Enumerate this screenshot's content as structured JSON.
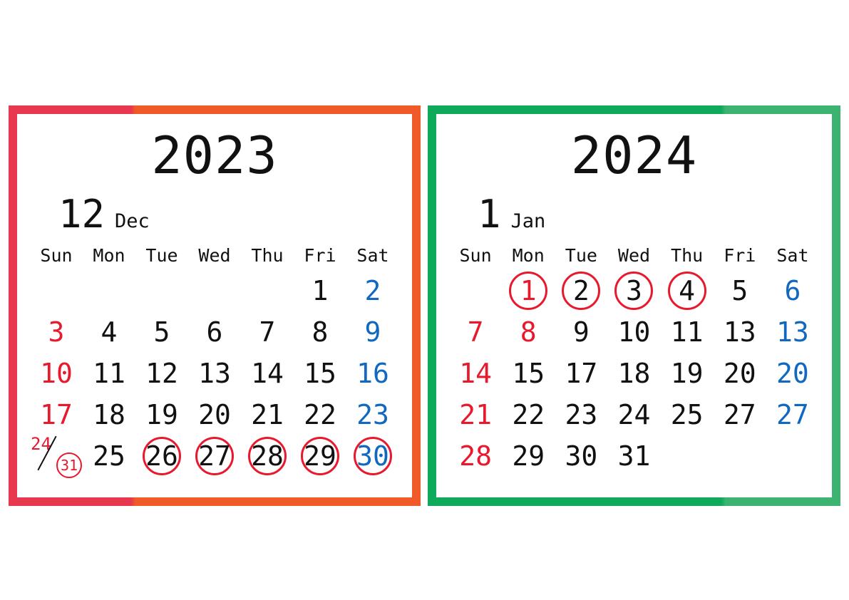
{
  "document": {
    "kind": "two-month-calendar",
    "background_color": "#FFFFFF"
  },
  "colors": {
    "sunday_red": "#E8192C",
    "saturday_blue": "#1068C0",
    "weekday_black": "#111111",
    "circle_red": "#E8192C",
    "dec_border_left": "#E8384F",
    "dec_border_right": "#F05A28",
    "jan_border_left": "#0EA95A",
    "jan_border_right": "#3CB371"
  },
  "calendars": [
    {
      "id": "december-2023",
      "year": "2023",
      "month_number": "12",
      "month_abbr": "Dec",
      "weekday_headers": [
        {
          "label": "Sun",
          "tone": "sun"
        },
        {
          "label": "Mon",
          "tone": "wk"
        },
        {
          "label": "Tue",
          "tone": "wk"
        },
        {
          "label": "Wed",
          "tone": "wk"
        },
        {
          "label": "Thu",
          "tone": "wk"
        },
        {
          "label": "Fri",
          "tone": "wk"
        },
        {
          "label": "Sat",
          "tone": "sat"
        }
      ],
      "weeks": [
        [
          {
            "label": "",
            "tone": "wk",
            "circled": false,
            "empty": true
          },
          {
            "label": "",
            "tone": "wk",
            "circled": false,
            "empty": true
          },
          {
            "label": "",
            "tone": "wk",
            "circled": false,
            "empty": true
          },
          {
            "label": "",
            "tone": "wk",
            "circled": false,
            "empty": true
          },
          {
            "label": "",
            "tone": "wk",
            "circled": false,
            "empty": true
          },
          {
            "label": "1",
            "tone": "wk",
            "circled": false
          },
          {
            "label": "2",
            "tone": "sat",
            "circled": false
          }
        ],
        [
          {
            "label": "3",
            "tone": "sun",
            "circled": false
          },
          {
            "label": "4",
            "tone": "wk",
            "circled": false
          },
          {
            "label": "5",
            "tone": "wk",
            "circled": false
          },
          {
            "label": "6",
            "tone": "wk",
            "circled": false
          },
          {
            "label": "7",
            "tone": "wk",
            "circled": false
          },
          {
            "label": "8",
            "tone": "wk",
            "circled": false
          },
          {
            "label": "9",
            "tone": "sat",
            "circled": false
          }
        ],
        [
          {
            "label": "10",
            "tone": "sun",
            "circled": false
          },
          {
            "label": "11",
            "tone": "wk",
            "circled": false
          },
          {
            "label": "12",
            "tone": "wk",
            "circled": false
          },
          {
            "label": "13",
            "tone": "wk",
            "circled": false
          },
          {
            "label": "14",
            "tone": "wk",
            "circled": false
          },
          {
            "label": "15",
            "tone": "wk",
            "circled": false
          },
          {
            "label": "16",
            "tone": "sat",
            "circled": false
          }
        ],
        [
          {
            "label": "17",
            "tone": "sun",
            "circled": false
          },
          {
            "label": "18",
            "tone": "wk",
            "circled": false
          },
          {
            "label": "19",
            "tone": "wk",
            "circled": false
          },
          {
            "label": "20",
            "tone": "wk",
            "circled": false
          },
          {
            "label": "21",
            "tone": "wk",
            "circled": false
          },
          {
            "label": "22",
            "tone": "wk",
            "circled": false
          },
          {
            "label": "23",
            "tone": "sat",
            "circled": false
          }
        ],
        [
          {
            "split": true,
            "top_label": "24",
            "bottom_label": "31",
            "tone": "sun",
            "bottom_circled": true
          },
          {
            "label": "25",
            "tone": "wk",
            "circled": false
          },
          {
            "label": "26",
            "tone": "wk",
            "circled": true
          },
          {
            "label": "27",
            "tone": "wk",
            "circled": true
          },
          {
            "label": "28",
            "tone": "wk",
            "circled": true
          },
          {
            "label": "29",
            "tone": "wk",
            "circled": true
          },
          {
            "label": "30",
            "tone": "sat",
            "circled": true
          }
        ]
      ]
    },
    {
      "id": "january-2024",
      "year": "2024",
      "month_number": "1",
      "month_abbr": "Jan",
      "weekday_headers": [
        {
          "label": "Sun",
          "tone": "sun"
        },
        {
          "label": "Mon",
          "tone": "wk"
        },
        {
          "label": "Tue",
          "tone": "wk"
        },
        {
          "label": "Wed",
          "tone": "wk"
        },
        {
          "label": "Thu",
          "tone": "wk"
        },
        {
          "label": "Fri",
          "tone": "wk"
        },
        {
          "label": "Sat",
          "tone": "sat"
        }
      ],
      "weeks": [
        [
          {
            "label": "",
            "tone": "wk",
            "circled": false,
            "empty": true
          },
          {
            "label": "1",
            "tone": "sun",
            "circled": true
          },
          {
            "label": "2",
            "tone": "wk",
            "circled": true
          },
          {
            "label": "3",
            "tone": "wk",
            "circled": true
          },
          {
            "label": "4",
            "tone": "wk",
            "circled": true
          },
          {
            "label": "5",
            "tone": "wk",
            "circled": false
          },
          {
            "label": "6",
            "tone": "sat",
            "circled": false
          }
        ],
        [
          {
            "label": "7",
            "tone": "sun",
            "circled": false
          },
          {
            "label": "8",
            "tone": "sun",
            "circled": false
          },
          {
            "label": "9",
            "tone": "wk",
            "circled": false
          },
          {
            "label": "10",
            "tone": "wk",
            "circled": false
          },
          {
            "label": "11",
            "tone": "wk",
            "circled": false
          },
          {
            "label": "13",
            "tone": "wk",
            "circled": false
          },
          {
            "label": "13",
            "tone": "sat",
            "circled": false
          }
        ],
        [
          {
            "label": "14",
            "tone": "sun",
            "circled": false
          },
          {
            "label": "15",
            "tone": "wk",
            "circled": false
          },
          {
            "label": "17",
            "tone": "wk",
            "circled": false
          },
          {
            "label": "18",
            "tone": "wk",
            "circled": false
          },
          {
            "label": "19",
            "tone": "wk",
            "circled": false
          },
          {
            "label": "20",
            "tone": "wk",
            "circled": false
          },
          {
            "label": "20",
            "tone": "sat",
            "circled": false
          }
        ],
        [
          {
            "label": "21",
            "tone": "sun",
            "circled": false
          },
          {
            "label": "22",
            "tone": "wk",
            "circled": false
          },
          {
            "label": "23",
            "tone": "wk",
            "circled": false
          },
          {
            "label": "24",
            "tone": "wk",
            "circled": false
          },
          {
            "label": "25",
            "tone": "wk",
            "circled": false
          },
          {
            "label": "27",
            "tone": "wk",
            "circled": false
          },
          {
            "label": "27",
            "tone": "sat",
            "circled": false
          }
        ],
        [
          {
            "label": "28",
            "tone": "sun",
            "circled": false
          },
          {
            "label": "29",
            "tone": "wk",
            "circled": false
          },
          {
            "label": "30",
            "tone": "wk",
            "circled": false
          },
          {
            "label": "31",
            "tone": "wk",
            "circled": false
          },
          {
            "label": "",
            "tone": "wk",
            "circled": false,
            "empty": true
          },
          {
            "label": "",
            "tone": "wk",
            "circled": false,
            "empty": true
          },
          {
            "label": "",
            "tone": "wk",
            "circled": false,
            "empty": true
          }
        ]
      ]
    }
  ]
}
